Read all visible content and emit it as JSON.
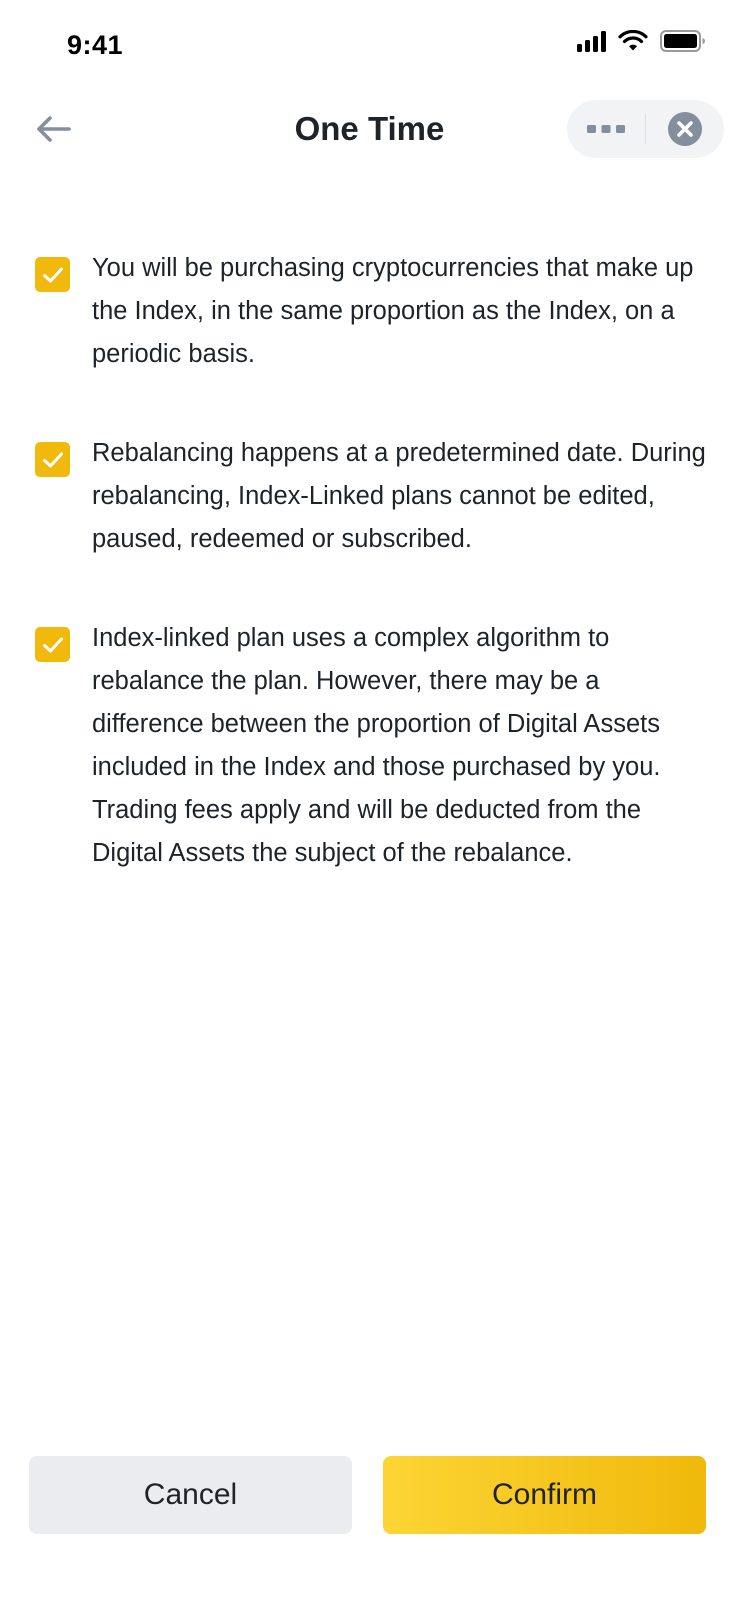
{
  "status_bar": {
    "time": "9:41",
    "icons": [
      "cellular-signal-icon",
      "wifi-icon",
      "battery-icon"
    ]
  },
  "header": {
    "back_icon": "arrow-left-icon",
    "title": "One Time",
    "more_icon": "more-dots-icon",
    "close_icon": "close-circle-icon"
  },
  "checklist": {
    "items": [
      {
        "checked": true,
        "text": "You will be purchasing cryptocurrencies that make up the Index, in the same proportion as the Index, on a periodic basis."
      },
      {
        "checked": true,
        "text": "Rebalancing happens at a predetermined date. During rebalancing, Index-Linked plans cannot be edited, paused, redeemed or subscribed."
      },
      {
        "checked": true,
        "text": "Index-linked plan uses a complex algorithm to rebalance the plan. However, there may be a difference between the proportion of Digital Assets included in the Index and those purchased by you. Trading fees apply and will be deducted from the Digital Assets the subject of the rebalance."
      }
    ]
  },
  "actions": {
    "cancel_label": "Cancel",
    "confirm_label": "Confirm"
  },
  "colors": {
    "accent": "#F0B90B",
    "accent_light": "#FCD535",
    "text": "#1E2329",
    "secondary_button": "#EAECEF"
  }
}
